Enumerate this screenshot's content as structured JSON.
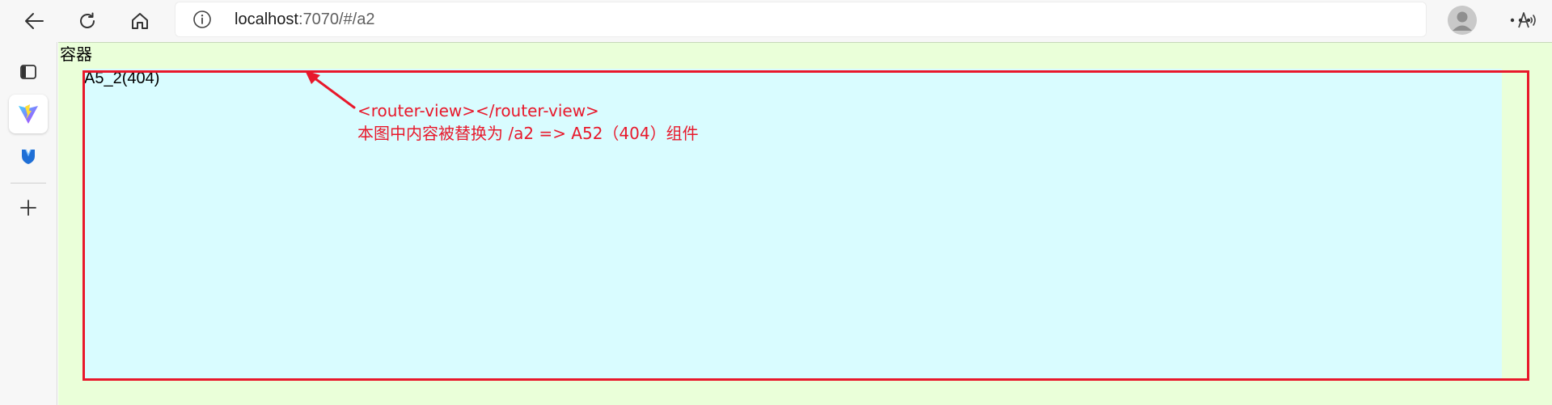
{
  "browser": {
    "address_bar": {
      "host": "localhost",
      "rest": ":7070/#/a2"
    },
    "icons": {
      "back": "arrow-left-icon",
      "refresh": "refresh-icon",
      "home": "home-icon",
      "site_info": "info-icon",
      "read_aloud": "read-aloud-icon",
      "favorite": "star-add-icon",
      "profile": "avatar-icon",
      "more": "more-dots-icon"
    }
  },
  "sidebar": {
    "items": [
      {
        "icon": "tab-actions-icon"
      },
      {
        "icon": "vite-logo-icon"
      },
      {
        "icon": "extension-shield-icon"
      },
      {
        "icon": "plus-icon"
      }
    ]
  },
  "page": {
    "container_label": "容器",
    "component_title": "A5_2(404)",
    "annotation": {
      "line1": "<router-view></router-view>",
      "line2": "本图中内容被替换为 /a2 => A52（404）组件"
    },
    "colors": {
      "page_background": "#eaffd9",
      "router_view_background": "#d9fcff",
      "annotation_red": "#e8182b"
    }
  }
}
